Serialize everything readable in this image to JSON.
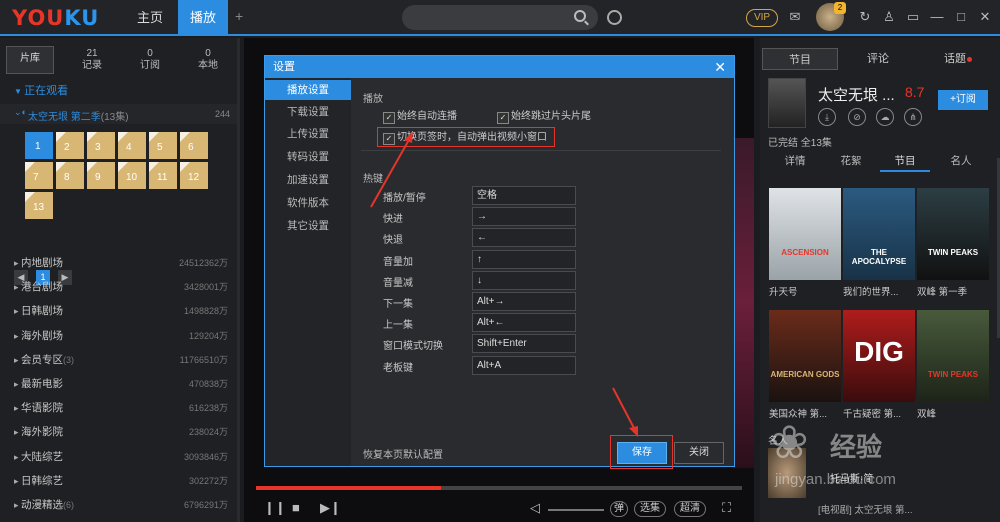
{
  "top": {
    "logo_red": "YOU",
    "logo_blue": "KU",
    "tabs": [
      "主页",
      "播放"
    ],
    "plus": "+",
    "vip": "VIP",
    "notif_count": "2",
    "icons": [
      "search-icon",
      "clock-icon",
      "mail-icon",
      "refresh-icon",
      "shirt-icon",
      "minimize-icon",
      "maximize-icon",
      "close-icon"
    ]
  },
  "left": {
    "tabs": [
      {
        "label": "片库",
        "count": ""
      },
      {
        "label": "记录",
        "count": "21"
      },
      {
        "label": "订阅",
        "count": "0"
      },
      {
        "label": "本地",
        "count": "0"
      }
    ],
    "watching": "正在观看",
    "now_title": "太空无垠 第二季",
    "now_eps": "(13集)",
    "now_num": "244",
    "episodes": [
      "1",
      "2",
      "3",
      "4",
      "5",
      "6",
      "7",
      "8",
      "9",
      "10",
      "11",
      "12",
      "13"
    ],
    "page": "1",
    "categories": [
      {
        "name": "内地剧场",
        "note": "",
        "value": "24512362万"
      },
      {
        "name": "港台剧场",
        "note": "",
        "value": "3428001万"
      },
      {
        "name": "日韩剧场",
        "note": "",
        "value": "1498828万"
      },
      {
        "name": "海外剧场",
        "note": "",
        "value": "129204万"
      },
      {
        "name": "会员专区",
        "note": "(3)",
        "value": "11766510万"
      },
      {
        "name": "最新电影",
        "note": "",
        "value": "470838万"
      },
      {
        "name": "华语影院",
        "note": "",
        "value": "616238万"
      },
      {
        "name": "海外影院",
        "note": "",
        "value": "238024万"
      },
      {
        "name": "大陆综艺",
        "note": "",
        "value": "3093846万"
      },
      {
        "name": "日韩综艺",
        "note": "",
        "value": "302272万"
      },
      {
        "name": "动漫精选",
        "note": "(6)",
        "value": "6796291万"
      }
    ]
  },
  "dialog": {
    "title": "设置",
    "close": "✕",
    "side": [
      "播放设置",
      "下载设置",
      "上传设置",
      "转码设置",
      "加速设置",
      "软件版本",
      "其它设置"
    ],
    "play_section": "播放",
    "cb1": "始终自动连播",
    "cb2": "始终跳过片头片尾",
    "cb3": "切换页签时，自动弹出视频小窗口",
    "hotkey_section": "热键",
    "hotkeys": [
      {
        "label": "播放/暂停",
        "key": "空格"
      },
      {
        "label": "快进",
        "key": "→"
      },
      {
        "label": "快退",
        "key": "←"
      },
      {
        "label": "音量加",
        "key": "↑"
      },
      {
        "label": "音量减",
        "key": "↓"
      },
      {
        "label": "下一集",
        "key": "Alt+→"
      },
      {
        "label": "上一集",
        "key": "Alt+←"
      },
      {
        "label": "窗口模式切换",
        "key": "Shift+Enter"
      },
      {
        "label": "老板键",
        "key": "Alt+A"
      }
    ],
    "restore": "恢复本页默认配置",
    "save": "保存",
    "cancel": "关闭"
  },
  "player": {
    "progress": 0.38,
    "danmu": "弹",
    "select": "选集",
    "quality": "超清"
  },
  "right": {
    "tabs": [
      "节目",
      "评论",
      "话题"
    ],
    "show_title": "太空无垠 ...",
    "score": "8.7",
    "subscribe": "+订阅",
    "meta": "已完结 全13集",
    "subtabs": [
      "详情",
      "花絮",
      "节目",
      "名人"
    ],
    "thumbs": [
      {
        "caption": "升天号",
        "text": "ASCENSION",
        "color": "#e8352a"
      },
      {
        "caption": "我们的世界...",
        "text": "THE APOCALYPSE",
        "color": "#ffffff"
      },
      {
        "caption": "双峰 第一季",
        "text": "TWIN PEAKS",
        "color": "#ffffff"
      },
      {
        "caption": "美国众神 第...",
        "text": "AMERICAN GODS",
        "color": "#d8b774"
      },
      {
        "caption": "千古疑密 第...",
        "text": "DIG",
        "color": "#ffffff"
      },
      {
        "caption": "双峰",
        "text": "TWIN PEAKS",
        "color": "#e8352a"
      }
    ],
    "person_label": "名人",
    "person_name": "托马斯·简",
    "person_role": "[电视剧] 太空无垠 第...",
    "watermark_jy": "经验",
    "watermark_url": "jingyan.baidu.com"
  }
}
